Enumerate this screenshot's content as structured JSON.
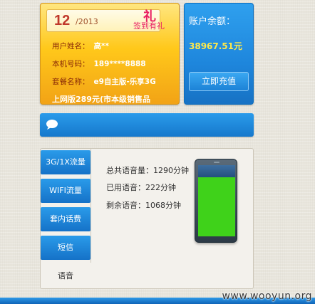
{
  "user_card": {
    "day": "12",
    "year": "/2013",
    "gift_char": "礼",
    "gift_text": "签到有礼",
    "rows": [
      {
        "label": "用户姓名：",
        "value": "高**"
      },
      {
        "label": "本机号码：",
        "value": "189****8888"
      },
      {
        "label": "套餐名称：",
        "value": "e9自主版-乐享3G"
      }
    ],
    "plan_line": "上网版289元(市本级销售品"
  },
  "balance_card": {
    "label": "账户余额：",
    "value": "38967.51元",
    "recharge_label": "立即充值"
  },
  "message_bar": {
    "icon": "chat-bubble-icon"
  },
  "tabs": [
    {
      "label": "3G/1X流量",
      "active": false
    },
    {
      "label": "WIFI流量",
      "active": false
    },
    {
      "label": "套内话费",
      "active": false
    },
    {
      "label": "短信",
      "active": false
    },
    {
      "label": "语音",
      "active": true
    }
  ],
  "voice": {
    "total": "总共语音量：1290分钟",
    "used": "已用语音：222分钟",
    "remaining": "剩余语音：1068分钟",
    "used_fraction": 0.17
  },
  "colors": {
    "accent_blue": "#1e86dc",
    "card_yellow": "#ffc81a",
    "balance_yellow": "#ffe94a",
    "phone_green": "#3fd21a"
  },
  "watermark": "www.wooyun.org"
}
